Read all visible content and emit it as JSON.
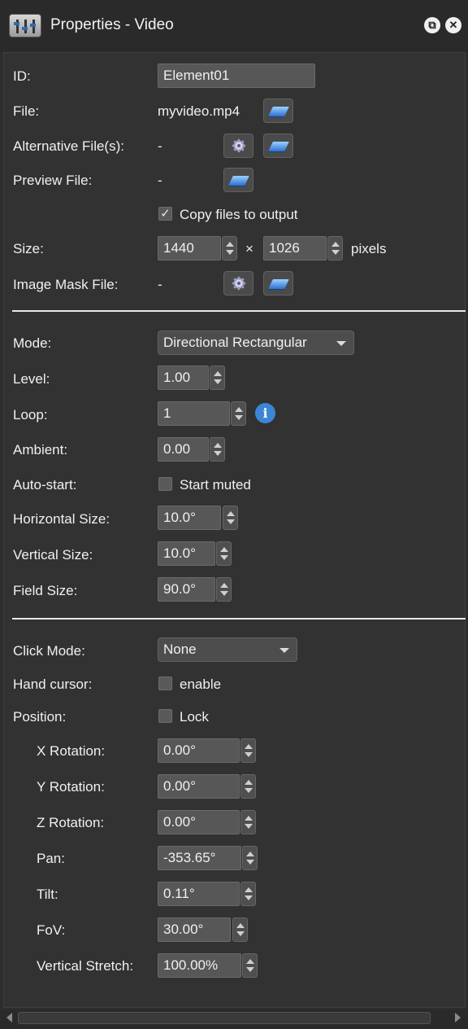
{
  "window": {
    "title": "Properties - Video",
    "restore_glyph": "⧉",
    "close_glyph": "✕"
  },
  "form": {
    "id_label": "ID:",
    "id_value": "Element01",
    "file_label": "File:",
    "file_value": "myvideo.mp4",
    "alt_label": "Alternative File(s):",
    "alt_value": "-",
    "preview_label": "Preview File:",
    "preview_value": "-",
    "copy_label": "Copy files to output",
    "copy_checked": "✓",
    "size_label": "Size:",
    "width": "1440",
    "times": "×",
    "height": "1026",
    "units": "pixels",
    "mask_label": "Image Mask File:",
    "mask_value": "-"
  },
  "audio": {
    "mode_label": "Mode:",
    "mode_value": "Directional Rectangular",
    "level_label": "Level:",
    "level_value": "1.00",
    "loop_label": "Loop:",
    "loop_value": "1",
    "info_glyph": "i",
    "ambient_label": "Ambient:",
    "ambient_value": "0.00",
    "autostart_label": "Auto-start:",
    "start_muted_label": "Start muted",
    "hsize_label": "Horizontal Size:",
    "hsize_value": "10.0°",
    "vsize_label": "Vertical Size:",
    "vsize_value": "10.0°",
    "fsize_label": "Field Size:",
    "fsize_value": "90.0°"
  },
  "interaction": {
    "click_label": "Click Mode:",
    "click_value": "None",
    "hand_label": "Hand cursor:",
    "hand_check_label": "enable",
    "position_label": "Position:",
    "lock_label": "Lock",
    "xrot_label": "X Rotation:",
    "xrot_value": "0.00°",
    "yrot_label": "Y Rotation:",
    "yrot_value": "0.00°",
    "zrot_label": "Z Rotation:",
    "zrot_value": "0.00°",
    "pan_label": "Pan:",
    "pan_value": "-353.65°",
    "tilt_label": "Tilt:",
    "tilt_value": "0.11°",
    "fov_label": "FoV:",
    "fov_value": "30.00°",
    "vstretch_label": "Vertical Stretch:",
    "vstretch_value": "100.00%"
  },
  "colors": {
    "background": "#323232",
    "field": "#575757",
    "accent": "#3d86d6"
  },
  "icons": [
    "app-icon",
    "restore-icon",
    "close-icon",
    "folder-icon",
    "gear-icon",
    "info-icon",
    "chevron-down-icon"
  ]
}
